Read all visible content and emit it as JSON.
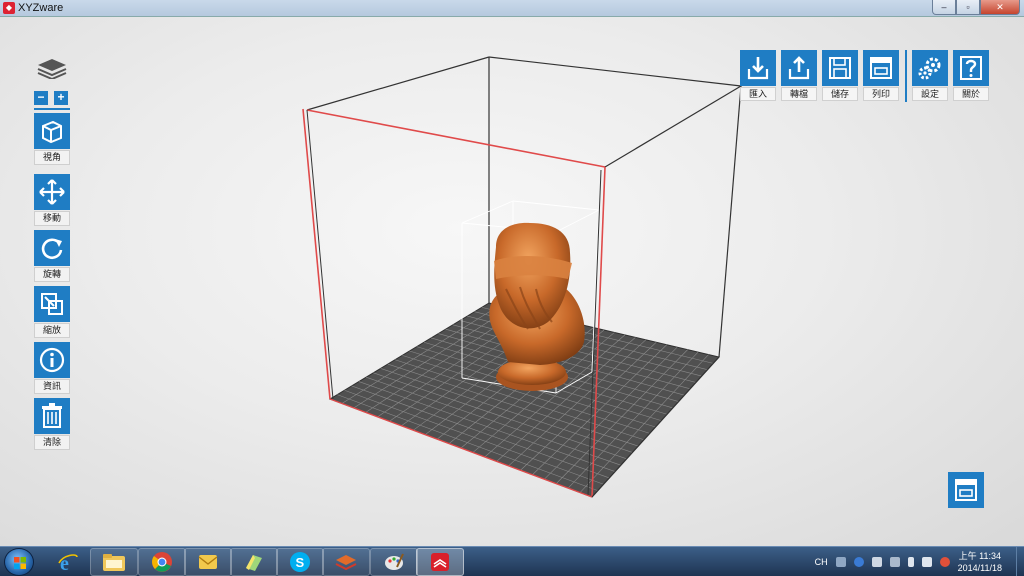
{
  "window": {
    "title": "XYZware",
    "controls": {
      "minimize": "‒",
      "maximize": "▫",
      "close": "✕"
    }
  },
  "left_toolbar": {
    "zoom_out": "−",
    "zoom_in": "+",
    "tools": [
      {
        "label": "視角",
        "icon": "cube-view-icon"
      },
      {
        "label": "移動",
        "icon": "move-arrows-icon"
      },
      {
        "label": "旋轉",
        "icon": "rotate-icon"
      },
      {
        "label": "縮放",
        "icon": "scale-icon"
      },
      {
        "label": "資訊",
        "icon": "info-icon"
      },
      {
        "label": "清除",
        "icon": "trash-icon"
      }
    ]
  },
  "right_toolbar": {
    "tools": [
      {
        "label": "匯入",
        "icon": "import-icon"
      },
      {
        "label": "轉檔",
        "icon": "convert-icon"
      },
      {
        "label": "儲存",
        "icon": "save-icon"
      },
      {
        "label": "列印",
        "icon": "print-icon"
      },
      {
        "label": "設定",
        "icon": "settings-gears-icon"
      },
      {
        "label": "關於",
        "icon": "help-icon"
      }
    ]
  },
  "colors": {
    "accent": "#1f7dc4",
    "model": "#c8692a",
    "bed": "#555555",
    "boundary_red": "#e04a4a"
  },
  "taskbar": {
    "apps": [
      "internet-explorer-icon",
      "file-explorer-icon",
      "chrome-icon",
      "outlook-icon",
      "notepad-icon",
      "skype-icon",
      "xyzware-layers-icon",
      "paint-icon",
      "xyzware-app-icon"
    ],
    "input_lang": "CH",
    "time": "上午 11:34",
    "date": "2014/11/18"
  }
}
